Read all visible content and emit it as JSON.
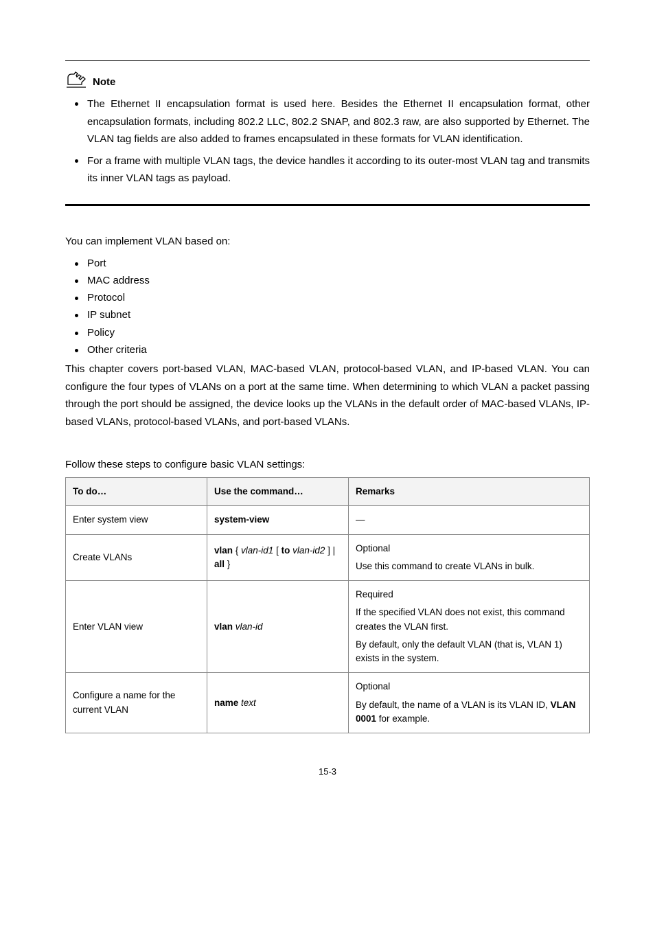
{
  "note": {
    "label": "Note",
    "items": [
      "The Ethernet II encapsulation format is used here. Besides the Ethernet II encapsulation format, other encapsulation formats, including 802.2 LLC, 802.2 SNAP, and 802.3 raw, are also supported by Ethernet. The VLAN tag fields are also added to frames encapsulated in these formats for VLAN identification.",
      "For a frame with multiple VLAN tags, the device handles it according to its outer-most VLAN tag and transmits its inner VLAN tags as payload."
    ]
  },
  "vlan_types": {
    "lead": "You can implement VLAN based on:",
    "items": [
      "Port",
      "MAC address",
      "Protocol",
      "IP subnet",
      "Policy",
      "Other criteria"
    ],
    "paragraph": "This chapter covers port-based VLAN, MAC-based VLAN, protocol-based VLAN, and IP-based VLAN. You can configure the four types of VLANs on a port at the same time. When determining to which VLAN a packet passing through the port should be assigned, the device looks up the VLANs in the default order of MAC-based VLANs, IP-based VLANs, protocol-based VLANs, and port-based VLANs."
  },
  "table": {
    "caption": "Follow these steps to configure basic VLAN settings:",
    "headers": {
      "c1": "To do…",
      "c2": "Use the command…",
      "c3": "Remarks"
    },
    "rows": [
      {
        "todo": "Enter system view",
        "cmd_bold": "system-view",
        "remarks": [
          "—"
        ]
      },
      {
        "todo": "Create VLANs",
        "cmd_parts": {
          "a": "vlan",
          "b": " { ",
          "c": "vlan-id1",
          "d": " [ ",
          "e": "to",
          "f": " ",
          "g": "vlan-id2",
          "h": " ] | ",
          "i": "all",
          "j": " }"
        },
        "remarks": [
          "Optional",
          "Use this command to create VLANs in bulk."
        ]
      },
      {
        "todo": "Enter VLAN view",
        "cmd_parts": {
          "a": "vlan",
          "b": " ",
          "c": "vlan-id"
        },
        "remarks": [
          "Required",
          "If the specified VLAN does not exist, this command creates the VLAN first.",
          "By default, only the default VLAN (that is, VLAN 1) exists in the system."
        ]
      },
      {
        "todo": "Configure a name for the current VLAN",
        "cmd_parts": {
          "a": "name",
          "b": " ",
          "c": "text"
        },
        "remarks_rich": {
          "r1": "Optional",
          "r2a": "By default, the name of a VLAN is its VLAN ID, ",
          "r2b": "VLAN 0001",
          "r2c": " for example."
        }
      }
    ]
  },
  "footer": "15-3"
}
